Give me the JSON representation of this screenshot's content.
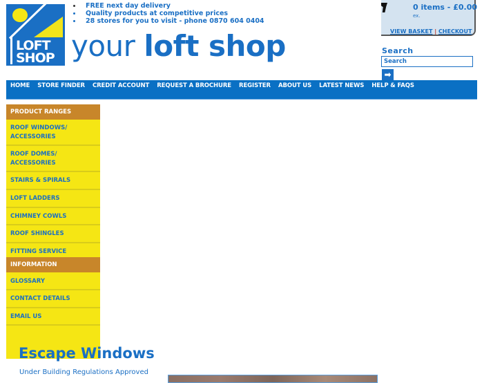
{
  "brand": {
    "logo_line1": "LOFT",
    "logo_line2": "SHOP",
    "tagline_light": "your",
    "tagline_bold": "loft shop"
  },
  "usps": [
    "FREE next day delivery",
    "Quality products at competitive prices",
    "28 stores for you to visit - phone 0870 604 0404"
  ],
  "basket": {
    "summary": "0 items - £0.00",
    "ex_label": "ex.",
    "view_basket": "VIEW BASKET",
    "separator": "|",
    "checkout": "CHECKOUT",
    "icon": "cart-icon"
  },
  "search": {
    "label": "Search",
    "value": "Search",
    "go_icon": "arrow-right-icon",
    "go_glyph": "➡"
  },
  "nav": [
    "HOME",
    "STORE FINDER",
    "CREDIT ACCOUNT",
    "REQUEST A BROCHURE",
    "REGISTER",
    "ABOUT US",
    "LATEST NEWS",
    "HELP & FAQS"
  ],
  "sidebar": {
    "product_heading": "PRODUCT RANGES",
    "products": [
      "ROOF WINDOWS/ ACCESSORIES",
      "ROOF DOMES/ ACCESSORIES",
      "STAIRS & SPIRALS",
      "LOFT LADDERS",
      "CHIMNEY COWLS",
      "ROOF SHINGLES",
      "FITTING SERVICE"
    ],
    "info_heading": "INFORMATION",
    "info": [
      "GLOSSARY",
      "CONTACT DETAILS",
      "EMAIL US"
    ]
  },
  "main": {
    "title": "Escape Windows",
    "subtitle": "Under Building Regulations Approved"
  },
  "colors": {
    "brand_blue": "#1a6fc4",
    "nav_blue": "#0a70c4",
    "sidebar_yellow": "#f5e614",
    "heading_orange": "#c8862a",
    "basket_bg": "#d4e3f0"
  }
}
